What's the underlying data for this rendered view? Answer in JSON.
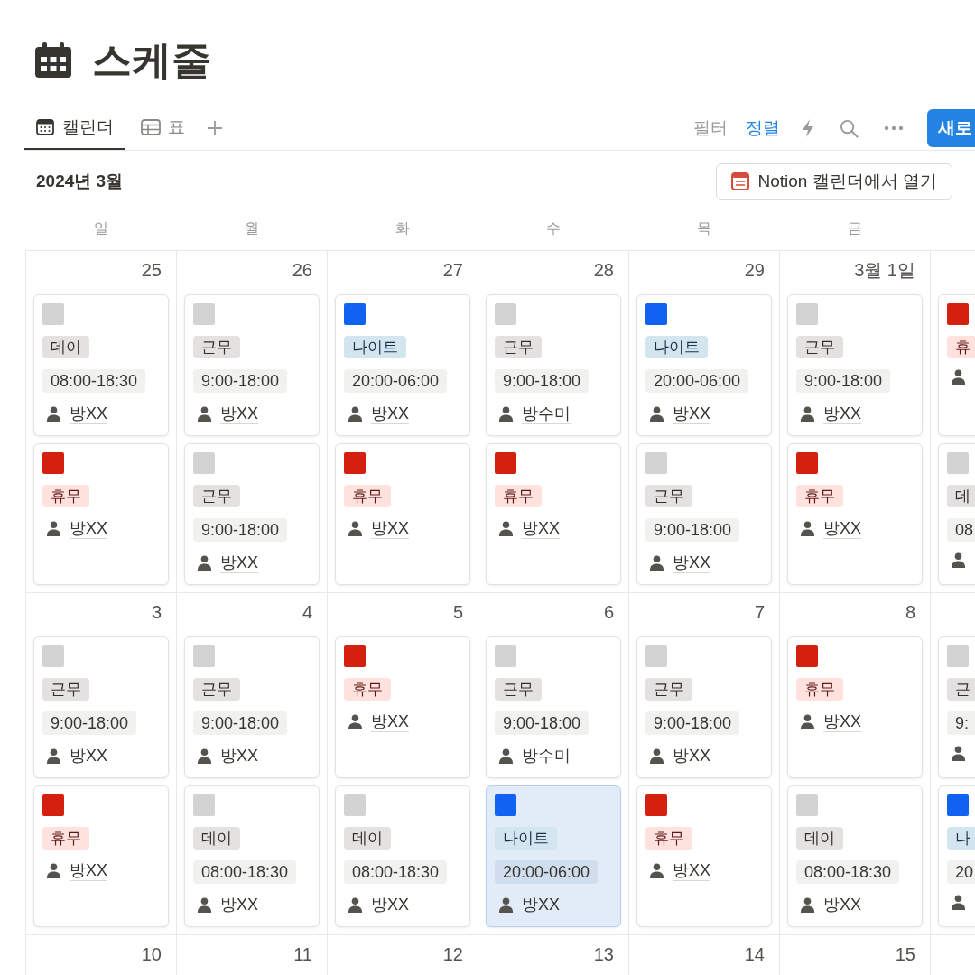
{
  "page": {
    "title": "스케줄"
  },
  "views": [
    {
      "label": "캘린더",
      "kind": "calendar",
      "selected": true
    },
    {
      "label": "표",
      "kind": "table",
      "selected": false
    }
  ],
  "toolbar": {
    "filter": "필터",
    "sort": "정렬",
    "new_button": "새로"
  },
  "month": "2024년 3월",
  "open_button": "Notion 캘린더에서 열기",
  "weekdays": [
    "일",
    "월",
    "화",
    "수",
    "목",
    "금"
  ],
  "weeks": [
    {
      "days": [
        {
          "date": "25",
          "events": [
            {
              "color": "#d3d3d3",
              "tag": "데이",
              "kind": "plain",
              "time": "08:00-18:30",
              "person": "방XX",
              "selected": false
            },
            {
              "color": "#d4200f",
              "tag": "휴무",
              "kind": "off",
              "person": "방XX",
              "selected": false
            }
          ]
        },
        {
          "date": "26",
          "events": [
            {
              "color": "#d3d3d3",
              "tag": "근무",
              "kind": "plain",
              "time": "9:00-18:00",
              "person": "방XX",
              "selected": false
            },
            {
              "color": "#d3d3d3",
              "tag": "근무",
              "kind": "plain",
              "time": "9:00-18:00",
              "person": "방XX",
              "selected": false
            }
          ]
        },
        {
          "date": "27",
          "events": [
            {
              "color": "#1062f0",
              "tag": "나이트",
              "kind": "night",
              "time": "20:00-06:00",
              "person": "방XX",
              "selected": false
            },
            {
              "color": "#d4200f",
              "tag": "휴무",
              "kind": "off",
              "person": "방XX",
              "selected": false
            }
          ]
        },
        {
          "date": "28",
          "events": [
            {
              "color": "#d3d3d3",
              "tag": "근무",
              "kind": "plain",
              "time": "9:00-18:00",
              "person": "방수미",
              "selected": false
            },
            {
              "color": "#d4200f",
              "tag": "휴무",
              "kind": "off",
              "person": "방XX",
              "selected": false
            }
          ]
        },
        {
          "date": "29",
          "events": [
            {
              "color": "#1062f0",
              "tag": "나이트",
              "kind": "night",
              "time": "20:00-06:00",
              "person": "방XX",
              "selected": false
            },
            {
              "color": "#d3d3d3",
              "tag": "근무",
              "kind": "plain",
              "time": "9:00-18:00",
              "person": "방XX",
              "selected": false
            }
          ]
        },
        {
          "date": "3월 1일",
          "events": [
            {
              "color": "#d3d3d3",
              "tag": "근무",
              "kind": "plain",
              "time": "9:00-18:00",
              "person": "방XX",
              "selected": false
            },
            {
              "color": "#d4200f",
              "tag": "휴무",
              "kind": "off",
              "person": "방XX",
              "selected": false
            }
          ]
        },
        {
          "events": [
            {
              "color": "#d4200f",
              "tag": "휴",
              "kind": "off",
              "selected": false
            },
            {
              "color": "#d3d3d3",
              "tag": "데",
              "kind": "plain",
              "time": "08",
              "selected": false
            }
          ]
        }
      ]
    },
    {
      "days": [
        {
          "date": "3",
          "events": [
            {
              "color": "#d3d3d3",
              "tag": "근무",
              "kind": "plain",
              "time": "9:00-18:00",
              "person": "방XX",
              "selected": false
            },
            {
              "color": "#d4200f",
              "tag": "휴무",
              "kind": "off",
              "person": "방XX",
              "selected": false
            }
          ]
        },
        {
          "date": "4",
          "events": [
            {
              "color": "#d3d3d3",
              "tag": "근무",
              "kind": "plain",
              "time": "9:00-18:00",
              "person": "방XX",
              "selected": false
            },
            {
              "color": "#d3d3d3",
              "tag": "데이",
              "kind": "plain",
              "time": "08:00-18:30",
              "person": "방XX",
              "selected": false
            }
          ]
        },
        {
          "date": "5",
          "events": [
            {
              "color": "#d4200f",
              "tag": "휴무",
              "kind": "off",
              "person": "방XX",
              "selected": false
            },
            {
              "color": "#d3d3d3",
              "tag": "데이",
              "kind": "plain",
              "time": "08:00-18:30",
              "person": "방XX",
              "selected": false
            }
          ]
        },
        {
          "date": "6",
          "events": [
            {
              "color": "#d3d3d3",
              "tag": "근무",
              "kind": "plain",
              "time": "9:00-18:00",
              "person": "방수미",
              "selected": false
            },
            {
              "color": "#1062f0",
              "tag": "나이트",
              "kind": "night",
              "time": "20:00-06:00",
              "person": "방XX",
              "selected": true
            }
          ]
        },
        {
          "date": "7",
          "events": [
            {
              "color": "#d3d3d3",
              "tag": "근무",
              "kind": "plain",
              "time": "9:00-18:00",
              "person": "방XX",
              "selected": false
            },
            {
              "color": "#d4200f",
              "tag": "휴무",
              "kind": "off",
              "person": "방XX",
              "selected": false
            }
          ]
        },
        {
          "date": "8",
          "events": [
            {
              "color": "#d4200f",
              "tag": "휴무",
              "kind": "off",
              "person": "방XX",
              "selected": false
            },
            {
              "color": "#d3d3d3",
              "tag": "데이",
              "kind": "plain",
              "time": "08:00-18:30",
              "person": "방XX",
              "selected": false
            }
          ]
        },
        {
          "events": [
            {
              "color": "#d3d3d3",
              "tag": "근",
              "kind": "plain",
              "time": "9:",
              "selected": false
            },
            {
              "color": "#1062f0",
              "tag": "나",
              "kind": "night",
              "time": "20",
              "selected": false
            }
          ]
        }
      ]
    },
    {
      "days": [
        {
          "date": "10"
        },
        {
          "date": "11"
        },
        {
          "date": "12"
        },
        {
          "date": "13"
        },
        {
          "date": "14"
        },
        {
          "date": "15"
        }
      ]
    }
  ]
}
